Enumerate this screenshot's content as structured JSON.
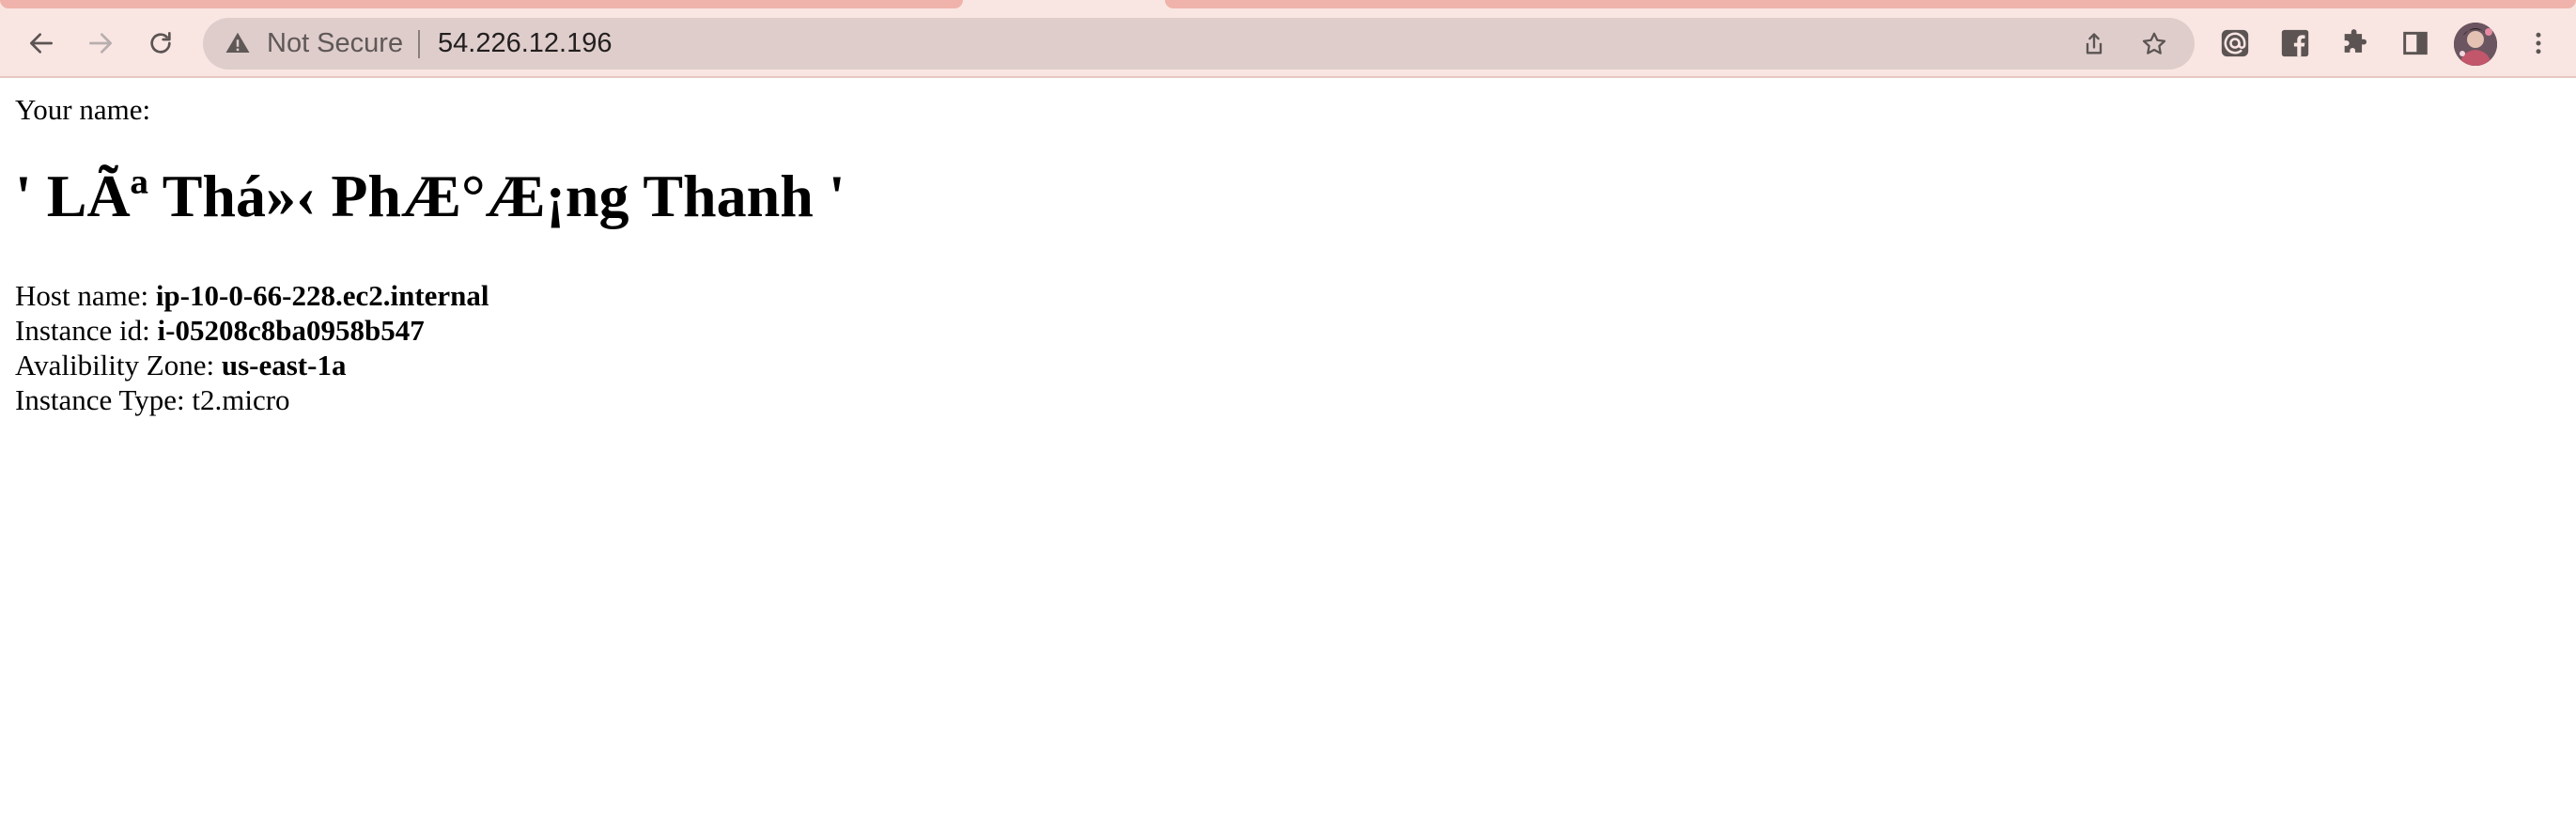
{
  "browser": {
    "security_label": "Not Secure",
    "url": "54.226.12.196"
  },
  "page": {
    "name_label": "Your name:",
    "name_value": "' LÃª Thá»‹ PhÆ°Æ¡ng Thanh '",
    "host_label": "Host name: ",
    "host_value": "ip-10-0-66-228.ec2.internal",
    "instance_label": "Instance id: ",
    "instance_value": "i-05208c8ba0958b547",
    "zone_label": "Avalibility Zone: ",
    "zone_value": "us-east-1a",
    "type_label": "Instance Type: ",
    "type_value": "t2.micro"
  },
  "icons": {
    "back": "arrow-left",
    "forward": "arrow-right",
    "reload": "reload",
    "warning": "warning-triangle",
    "share": "share",
    "bookmark": "star",
    "extension_1": "at-sign",
    "extension_2": "facebook",
    "extensions_menu": "puzzle",
    "side_panel": "side-panel",
    "menu": "kebab"
  },
  "colors": {
    "chrome_bg": "#f9e6e2",
    "tab_accent": "#efb3ab",
    "omnibox_bg": "#decdcb"
  }
}
